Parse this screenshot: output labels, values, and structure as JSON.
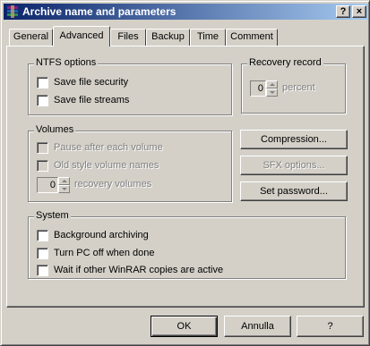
{
  "window": {
    "title": "Archive name and parameters",
    "help_glyph": "?",
    "close_glyph": "×"
  },
  "tabs": [
    {
      "label": "General"
    },
    {
      "label": "Advanced",
      "active": true
    },
    {
      "label": "Files"
    },
    {
      "label": "Backup"
    },
    {
      "label": "Time"
    },
    {
      "label": "Comment"
    }
  ],
  "ntfs": {
    "title": "NTFS options",
    "options": [
      {
        "label": "Save file security",
        "checked": false
      },
      {
        "label": "Save file streams",
        "checked": false
      }
    ]
  },
  "recovery": {
    "title": "Recovery record",
    "value": "0",
    "unit": "percent"
  },
  "volumes": {
    "title": "Volumes",
    "options": [
      {
        "label": "Pause after each volume",
        "checked": false,
        "enabled": false
      },
      {
        "label": "Old style volume names",
        "checked": false,
        "enabled": false
      }
    ],
    "recovery_value": "0",
    "recovery_label": "recovery volumes"
  },
  "side_buttons": {
    "compression": "Compression...",
    "sfx": "SFX options...",
    "password": "Set password..."
  },
  "system": {
    "title": "System",
    "options": [
      {
        "label": "Background archiving",
        "checked": false
      },
      {
        "label": "Turn PC off when done",
        "checked": false
      },
      {
        "label": "Wait if other WinRAR copies are active",
        "checked": false
      }
    ]
  },
  "footer": {
    "ok": "OK",
    "cancel": "Annulla",
    "help": "?"
  },
  "colors": {
    "face": "#d4d0c8",
    "title_start": "#0a246a",
    "title_end": "#a6caf0",
    "disabled_text": "#808080"
  }
}
